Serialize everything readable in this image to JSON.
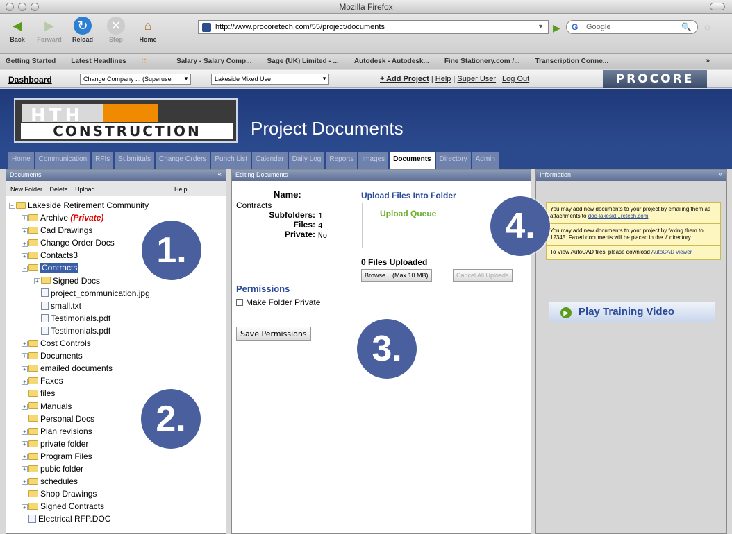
{
  "browser": {
    "window_title": "Mozilla Firefox",
    "nav": {
      "back": "Back",
      "forward": "Forward",
      "reload": "Reload",
      "stop": "Stop",
      "home": "Home"
    },
    "url": "http://www.procoretech.com/55/project/documents",
    "search_placeholder": "Google",
    "bookmarks": [
      "Getting Started",
      "Latest Headlines",
      "Salary - Salary Comp...",
      "Sage (UK) Limited - ...",
      "Autodesk - Autodesk...",
      "Fine Stationery.com /...",
      "Transcription Conne..."
    ],
    "bookmarks_more": "»"
  },
  "appbar": {
    "dashboard": "Dashboard",
    "company_select": "Change Company ... (Superuse",
    "project_select": "Lakeside Mixed Use",
    "add_project": "+ Add Project",
    "help": "Help",
    "super_user": "Super User",
    "log_out": "Log Out",
    "brand": "PROCORE"
  },
  "header": {
    "logo_top": "HTH",
    "logo_bottom": "CONSTRUCTION",
    "title": "Project Documents"
  },
  "tabs": [
    "Home",
    "Communication",
    "RFIs",
    "Submittals",
    "Change Orders",
    "Punch List",
    "Calendar",
    "Daily Log",
    "Reports",
    "Images",
    "Documents",
    "Directory",
    "Admin"
  ],
  "active_tab": "Documents",
  "left_panel": {
    "title": "Documents",
    "toolbar": {
      "new_folder": "New Folder",
      "delete": "Delete",
      "upload": "Upload",
      "help": "Help"
    },
    "root": "Lakeside Retirement Community",
    "items": [
      {
        "label": "Archive",
        "suffix": "(Private)"
      },
      {
        "label": "Cad Drawings"
      },
      {
        "label": "Change Order Docs"
      },
      {
        "label": "Contacts3"
      },
      {
        "label": "Contracts"
      },
      {
        "label": "Signed Docs"
      },
      {
        "label": "project_communication.jpg"
      },
      {
        "label": "small.txt"
      },
      {
        "label": "Testimonials.pdf"
      },
      {
        "label": "Testimonials.pdf"
      },
      {
        "label": "Cost Controls"
      },
      {
        "label": "Documents"
      },
      {
        "label": "emailed documents"
      },
      {
        "label": "Faxes"
      },
      {
        "label": "files"
      },
      {
        "label": "Manuals"
      },
      {
        "label": "Personal Docs"
      },
      {
        "label": "Plan revisions"
      },
      {
        "label": "private folder"
      },
      {
        "label": "Program Files"
      },
      {
        "label": "pubic folder"
      },
      {
        "label": "schedules"
      },
      {
        "label": "Shop Drawings"
      },
      {
        "label": "Signed Contracts"
      },
      {
        "label": "Electrical RFP.DOC"
      }
    ]
  },
  "middle_panel": {
    "title": "Editing Documents",
    "name_label": "Name:",
    "name_value": "Contracts",
    "subfolders_label": "Subfolders:",
    "subfolders_value": "1",
    "files_label": "Files:",
    "files_value": "4",
    "private_label": "Private:",
    "private_value": "No",
    "upload_title": "Upload Files Into Folder",
    "upload_queue": "Upload Queue",
    "files_uploaded": "0 Files Uploaded",
    "browse": "Browse... (Max 10 MB)",
    "cancel_uploads": "Cancel All Uploads",
    "permissions_title": "Permissions",
    "make_private": "Make Folder Private",
    "save_permissions": "Save Permissions"
  },
  "right_panel": {
    "title": "Information",
    "info1": "You may add new documents to your project by emailing them as attachments to",
    "info1_link": "doc-lakesid...retech.com",
    "info2": "You may add new documents to your project by faxing them to 12345. Faxed documents will be placed in the '/' directory.",
    "info3": "To View AutoCAD files, please download",
    "info3_link": "AutoCAD viewer",
    "play_video": "Play Training Video"
  },
  "callouts": [
    "1.",
    "2.",
    "3.",
    "4."
  ]
}
